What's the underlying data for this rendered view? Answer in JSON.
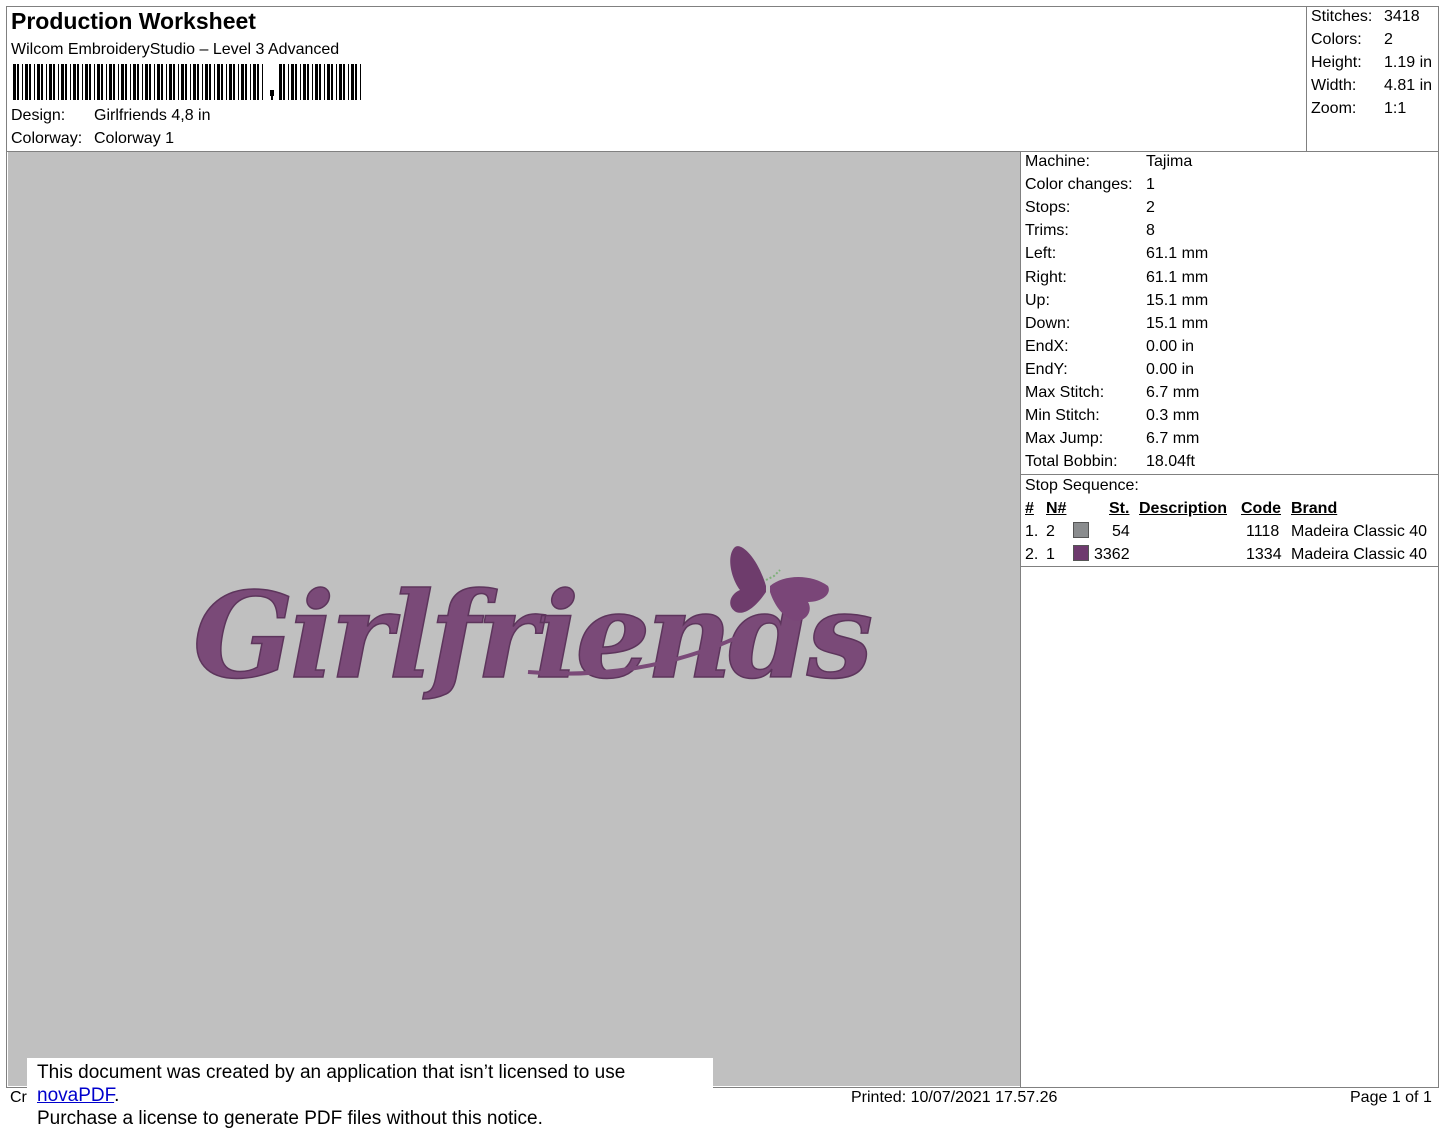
{
  "header": {
    "title": "Production Worksheet",
    "software": "Wilcom EmbroideryStudio – Level 3 Advanced",
    "design_label": "Design:",
    "design_value": "Girlfriends 4,8 in",
    "colorway_label": "Colorway:",
    "colorway_value": "Colorway 1"
  },
  "summary": [
    {
      "label": "Stitches:",
      "value": "3418"
    },
    {
      "label": "Colors:",
      "value": "2"
    },
    {
      "label": "Height:",
      "value": "1.19 in"
    },
    {
      "label": "Width:",
      "value": "4.81 in"
    },
    {
      "label": "Zoom:",
      "value": "1:1"
    }
  ],
  "details": [
    {
      "label": "Machine:",
      "value": "Tajima"
    },
    {
      "label": "Color changes:",
      "value": "1"
    },
    {
      "label": "Stops:",
      "value": "2"
    },
    {
      "label": "Trims:",
      "value": "8"
    },
    {
      "label": "Left:",
      "value": "61.1 mm"
    },
    {
      "label": "Right:",
      "value": "61.1 mm"
    },
    {
      "label": "Up:",
      "value": "15.1 mm"
    },
    {
      "label": "Down:",
      "value": "15.1 mm"
    },
    {
      "label": "EndX:",
      "value": "0.00 in"
    },
    {
      "label": "EndY:",
      "value": "0.00 in"
    },
    {
      "label": "Max Stitch:",
      "value": "6.7 mm"
    },
    {
      "label": "Min Stitch:",
      "value": "0.3 mm"
    },
    {
      "label": "Max Jump:",
      "value": "6.7 mm"
    },
    {
      "label": "Total Bobbin:",
      "value": "18.04ft"
    }
  ],
  "stop_sequence": {
    "title": "Stop Sequence:",
    "columns": [
      "#",
      "N#",
      "St.",
      "Description",
      "Code",
      "Brand"
    ],
    "rows": [
      {
        "index": "1.",
        "n": "2",
        "color": "#8a8c8e",
        "stitches": "54",
        "description": "",
        "code": "1118",
        "brand": "Madeira Classic 40"
      },
      {
        "index": "2.",
        "n": "1",
        "color": "#6e3a6e",
        "stitches": "3362",
        "description": "",
        "code": "1334",
        "brand": "Madeira Classic 40"
      }
    ]
  },
  "design_preview": {
    "text": "Girlfriends",
    "thread_color": "#7a4a78",
    "background": "#c0c0c0"
  },
  "notice": {
    "line1_prefix": "This document was created by an application that isn’t licensed to use ",
    "link": "novaPDF",
    "line1_suffix": ".",
    "line2": "Purchase a license to generate PDF files without this notice."
  },
  "footer": {
    "left": "Cr",
    "printed": "Printed: 10/07/2021 17.57.26",
    "page": "Page 1 of 1"
  }
}
